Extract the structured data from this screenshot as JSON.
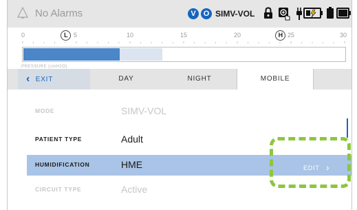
{
  "status_bar": {
    "alarm_text": "No Alarms",
    "badge_v": "V",
    "badge_o": "O",
    "mode": "SIMV-VOL",
    "icons": [
      "bell-icon",
      "lock-icon",
      "touch-icon",
      "plug-icon",
      "battery-charging-icon",
      "battery-icon",
      "battery-full-icon"
    ],
    "accent_color": "#1565c0"
  },
  "gauge": {
    "ticks": [
      "0",
      "5",
      "10",
      "15",
      "20",
      "25",
      "30"
    ],
    "low_marker": "L",
    "high_marker": "H",
    "low_value": 4,
    "high_value": 24,
    "fill_value": 9,
    "secondary_fill_value": 13,
    "max": 30,
    "label": "PRESSURE (cmH2O)"
  },
  "tabs": {
    "exit": "EXIT",
    "items": [
      "DAY",
      "NIGHT",
      "MOBILE"
    ],
    "active": "MOBILE"
  },
  "settings": [
    {
      "label": "MODE",
      "value": "SIMV-VOL",
      "state": "disabled"
    },
    {
      "label": "PATIENT TYPE",
      "value": "Adult",
      "state": "normal"
    },
    {
      "label": "HUMIDIFICATION",
      "value": "HME",
      "state": "selected",
      "action": "EDIT"
    },
    {
      "label": "CIRCUIT TYPE",
      "value": "Active",
      "state": "disabled"
    }
  ],
  "highlight_color": "#8dc63f"
}
